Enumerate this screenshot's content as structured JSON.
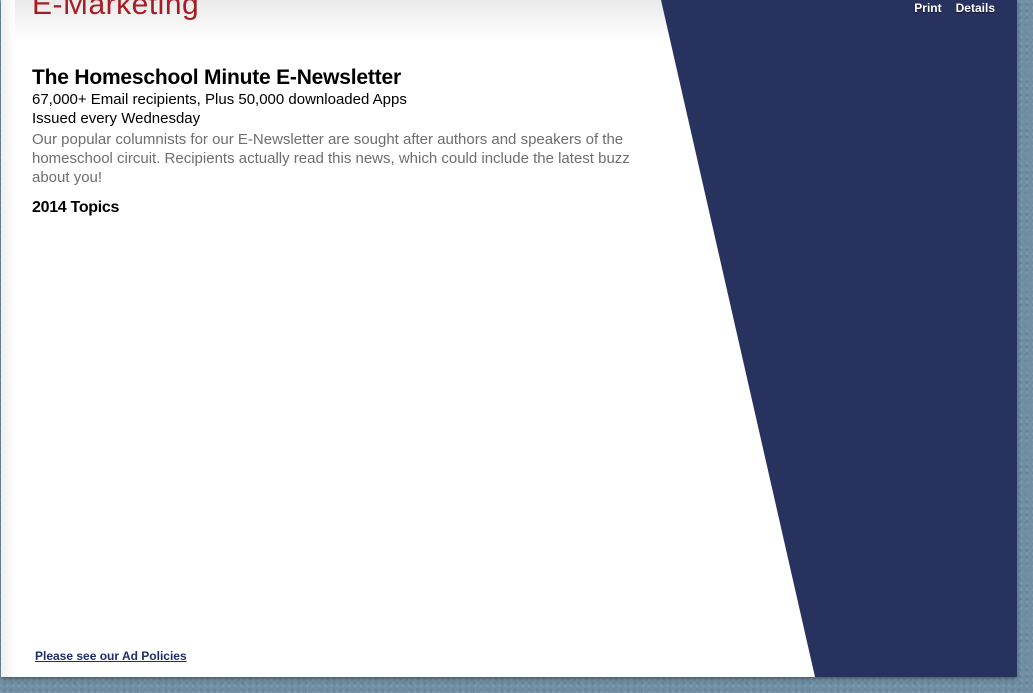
{
  "header": {
    "section_title": "E-Marketing"
  },
  "toolbar": {
    "print_label": "Print",
    "details_label": "Details"
  },
  "main": {
    "headline": "The Homeschool Minute E-Newsletter",
    "stats_line": "67,000+ Email recipients, Plus 50,000 downloaded Apps",
    "schedule_line": "Issued every Wednesday",
    "description": "Our popular columnists for our E-Newsletter are sought after authors and speakers of the homeschool circuit. Recipients actually read this news, which could include the latest buzz about you!",
    "topics_heading": "2014 Topics"
  },
  "footer": {
    "ad_policies_link": "Please see our Ad Policies"
  },
  "colors": {
    "navy": "#27325e",
    "title_red": "#a61c25",
    "description_gray": "#6e6e6e",
    "link_navy": "#1e2d6b",
    "background_blue": "#6f8fa3"
  }
}
